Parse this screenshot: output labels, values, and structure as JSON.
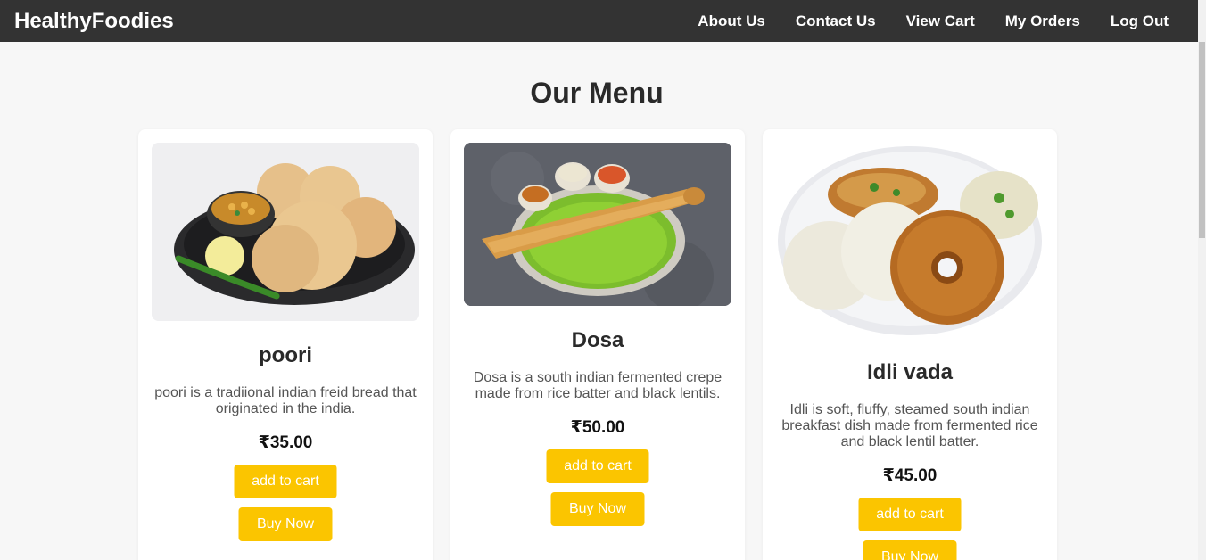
{
  "nav": {
    "brand": "HealthyFoodies",
    "links": [
      "About Us",
      "Contact Us",
      "View Cart",
      "My Orders",
      "Log Out"
    ]
  },
  "page": {
    "title": "Our Menu"
  },
  "items": [
    {
      "name": "poori",
      "description": "poori is a tradiional indian freid bread that originated in the india.",
      "price": "₹35.00",
      "add_to_cart": "add to cart",
      "buy_now": "Buy Now",
      "image": "poori-with-chole-icon"
    },
    {
      "name": "Dosa",
      "description": "Dosa is a south indian fermented crepe made from rice batter and black lentils.",
      "price": "₹50.00",
      "add_to_cart": "add to cart",
      "buy_now": "Buy Now",
      "image": "dosa-plate-icon"
    },
    {
      "name": "Idli vada",
      "description": "Idli is soft, fluffy, steamed south indian breakfast dish made from fermented rice and black lentil batter.",
      "price": "₹45.00",
      "add_to_cart": "add to cart",
      "buy_now": "Buy Now",
      "image": "idli-vada-plate-icon"
    }
  ],
  "colors": {
    "navbar": "#333333",
    "accent": "#fbc500",
    "background": "#f7f7f7"
  }
}
